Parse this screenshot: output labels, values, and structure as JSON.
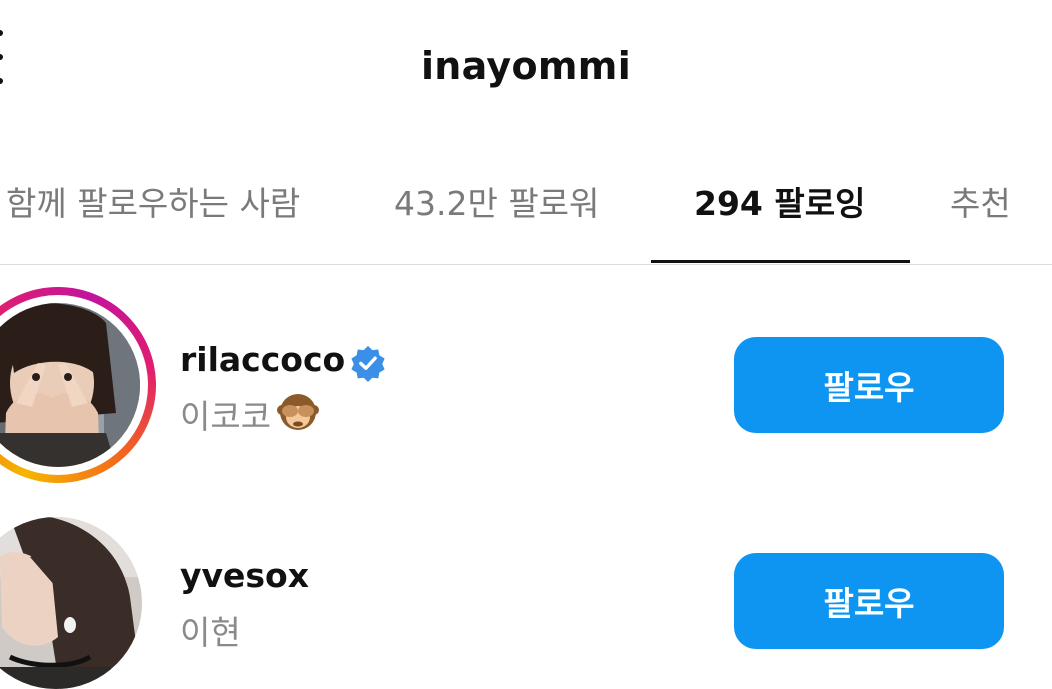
{
  "header": {
    "title": "inayommi"
  },
  "tabs": [
    {
      "label": "함께 팔로우하는 사람",
      "active": false
    },
    {
      "label": "43.2만 팔로워",
      "active": false
    },
    {
      "label": "294 팔로잉",
      "active": true
    },
    {
      "label": "추천",
      "active": false
    }
  ],
  "accounts": [
    {
      "username": "rilaccoco",
      "display_name": "이코코",
      "verified": true,
      "has_story_ring": true,
      "emoji": "see-no-evil-monkey",
      "follow_label": "팔로우"
    },
    {
      "username": "yvesox",
      "display_name": "이현",
      "verified": false,
      "has_story_ring": false,
      "follow_label": "팔로우"
    }
  ],
  "colors": {
    "follow_button": "#0d95f1",
    "verified_badge": "#3b8fe6",
    "active_tab_text": "#111111",
    "inactive_tab_text": "#7a7a7a",
    "story_ring": [
      "#f7b500",
      "#f26a1b",
      "#e01e6f",
      "#c2139c"
    ]
  }
}
